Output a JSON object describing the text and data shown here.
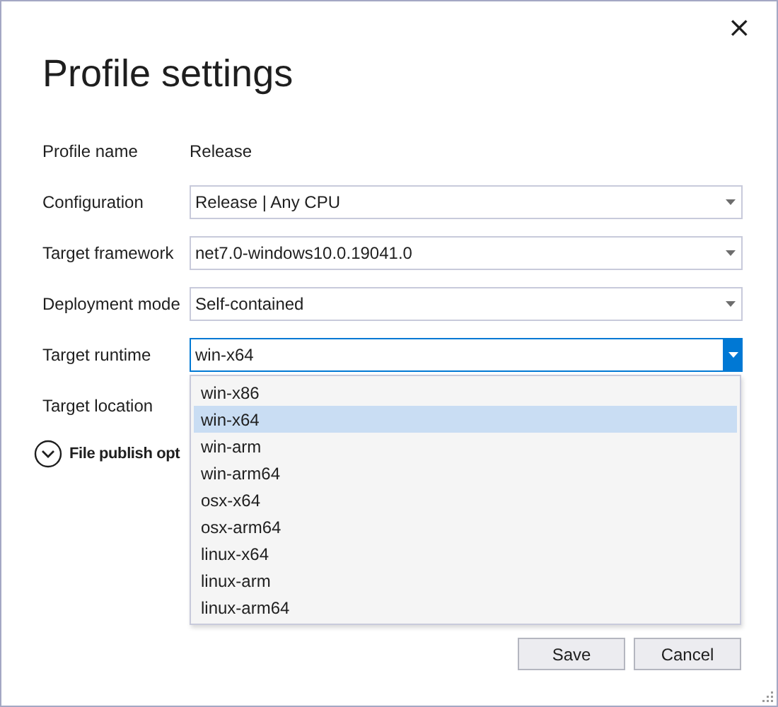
{
  "dialog": {
    "close_button": "×",
    "title": "Profile settings"
  },
  "fields": [
    {
      "kind": "text",
      "label": "Profile name",
      "value": "Release"
    },
    {
      "kind": "combo",
      "label": "Configuration",
      "value": "Release | Any CPU",
      "open": false
    },
    {
      "kind": "combo",
      "label": "Target framework",
      "value": "net7.0-windows10.0.19041.0",
      "open": false
    },
    {
      "kind": "combo",
      "label": "Deployment mode",
      "value": "Self-contained",
      "open": false
    },
    {
      "kind": "combo",
      "label": "Target runtime",
      "value": "win-x64",
      "open": true,
      "options": [
        {
          "label": "win-x86",
          "selected": false
        },
        {
          "label": "win-x64",
          "selected": true
        },
        {
          "label": "win-arm",
          "selected": false
        },
        {
          "label": "win-arm64",
          "selected": false
        },
        {
          "label": "osx-x64",
          "selected": false
        },
        {
          "label": "osx-arm64",
          "selected": false
        },
        {
          "label": "linux-x64",
          "selected": false
        },
        {
          "label": "linux-arm",
          "selected": false
        },
        {
          "label": "linux-arm64",
          "selected": false
        }
      ]
    },
    {
      "kind": "label",
      "label": "Target location"
    }
  ],
  "expander": {
    "label": "File publish opt",
    "expanded": false
  },
  "buttons": [
    "Save",
    "Cancel"
  ]
}
